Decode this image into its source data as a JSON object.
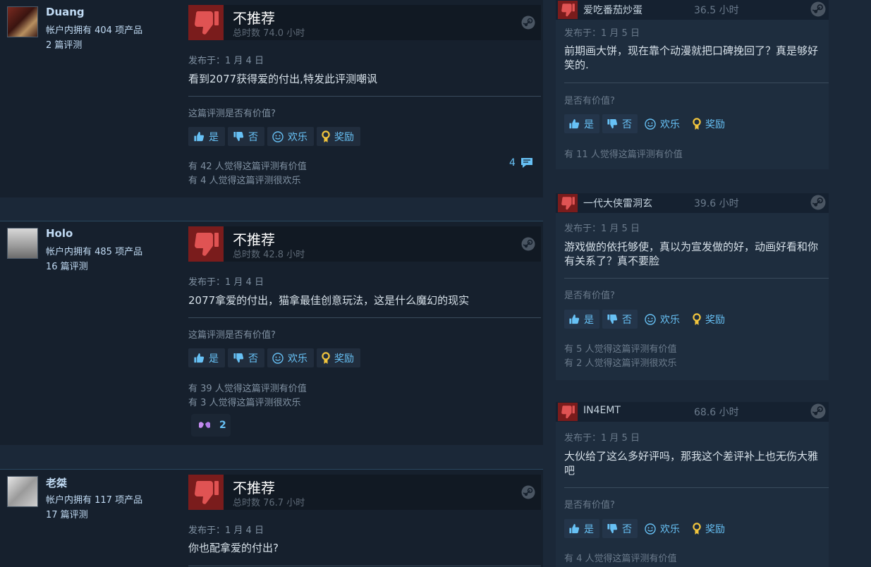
{
  "colors": {
    "background": "#1b2838",
    "link": "#67c1f5",
    "not_recommended": "#7a1c1c"
  },
  "left_reviews": [
    {
      "username": "Duang",
      "products": "帐户内拥有 404 项产品",
      "review_count": "2 篇评测",
      "verdict": "不推荐",
      "hours": "总时数 74.0 小时",
      "posted": "发布于：1 月 4 日",
      "content": "看到2077获得爱的付出,特发此评测嘲讽",
      "helpful_question": "这篇评测是否有价值?",
      "buttons": {
        "yes": "是",
        "no": "否",
        "funny": "欢乐",
        "award": "奖励"
      },
      "helpful_stat": "有 42 人觉得这篇评测有价值",
      "funny_stat": "有 4 人觉得这篇评测很欢乐",
      "comment_count": "4"
    },
    {
      "username": "Holo",
      "products": "帐户内拥有 485 项产品",
      "review_count": "16 篇评测",
      "verdict": "不推荐",
      "hours": "总时数 42.8 小时",
      "posted": "发布于：1 月 4 日",
      "content": "2077拿爱的付出，猫拿最佳创意玩法，这是什么魔幻的现实",
      "helpful_question": "这篇评测是否有价值?",
      "buttons": {
        "yes": "是",
        "no": "否",
        "funny": "欢乐",
        "award": "奖励"
      },
      "helpful_stat": "有 39 人觉得这篇评测有价值",
      "funny_stat": "有 3 人觉得这篇评测很欢乐",
      "award_count": "2"
    },
    {
      "username": "老桀",
      "products": "帐户内拥有 117 项产品",
      "review_count": "17 篇评测",
      "verdict": "不推荐",
      "hours": "总时数 76.7 小时",
      "posted": "发布于：1 月 4 日",
      "content": "你也配拿爱的付出?"
    }
  ],
  "right_reviews": [
    {
      "username": "爱吃番茄炒蛋",
      "hours": "36.5 小时",
      "posted": "发布于：1 月 5 日",
      "content": "前期画大饼，现在靠个动漫就把口碑挽回了？真是够好笑的.",
      "helpful_question": "是否有价值?",
      "buttons": {
        "yes": "是",
        "no": "否",
        "funny": "欢乐",
        "award": "奖励"
      },
      "helpful_stat": "有 11 人觉得这篇评测有价值"
    },
    {
      "username": "一代大侠雷洞玄",
      "hours": "39.6 小时",
      "posted": "发布于：1 月 5 日",
      "content": "游戏做的依托够使，真以为宣发做的好，动画好看和你有关系了？真不要脸",
      "helpful_question": "是否有价值?",
      "buttons": {
        "yes": "是",
        "no": "否",
        "funny": "欢乐",
        "award": "奖励"
      },
      "helpful_stat": "有 5 人觉得这篇评测有价值",
      "funny_stat": "有 2 人觉得这篇评测很欢乐"
    },
    {
      "username": "IN4EMT",
      "hours": "68.6 小时",
      "posted": "发布于：1 月 5 日",
      "content": "大伙给了这么多好评吗，那我这个差评补上也无伤大雅吧",
      "helpful_question": "是否有价值?",
      "buttons": {
        "yes": "是",
        "no": "否",
        "funny": "欢乐",
        "award": "奖励"
      },
      "helpful_stat": "有 4 人觉得这篇评测有价值"
    }
  ]
}
